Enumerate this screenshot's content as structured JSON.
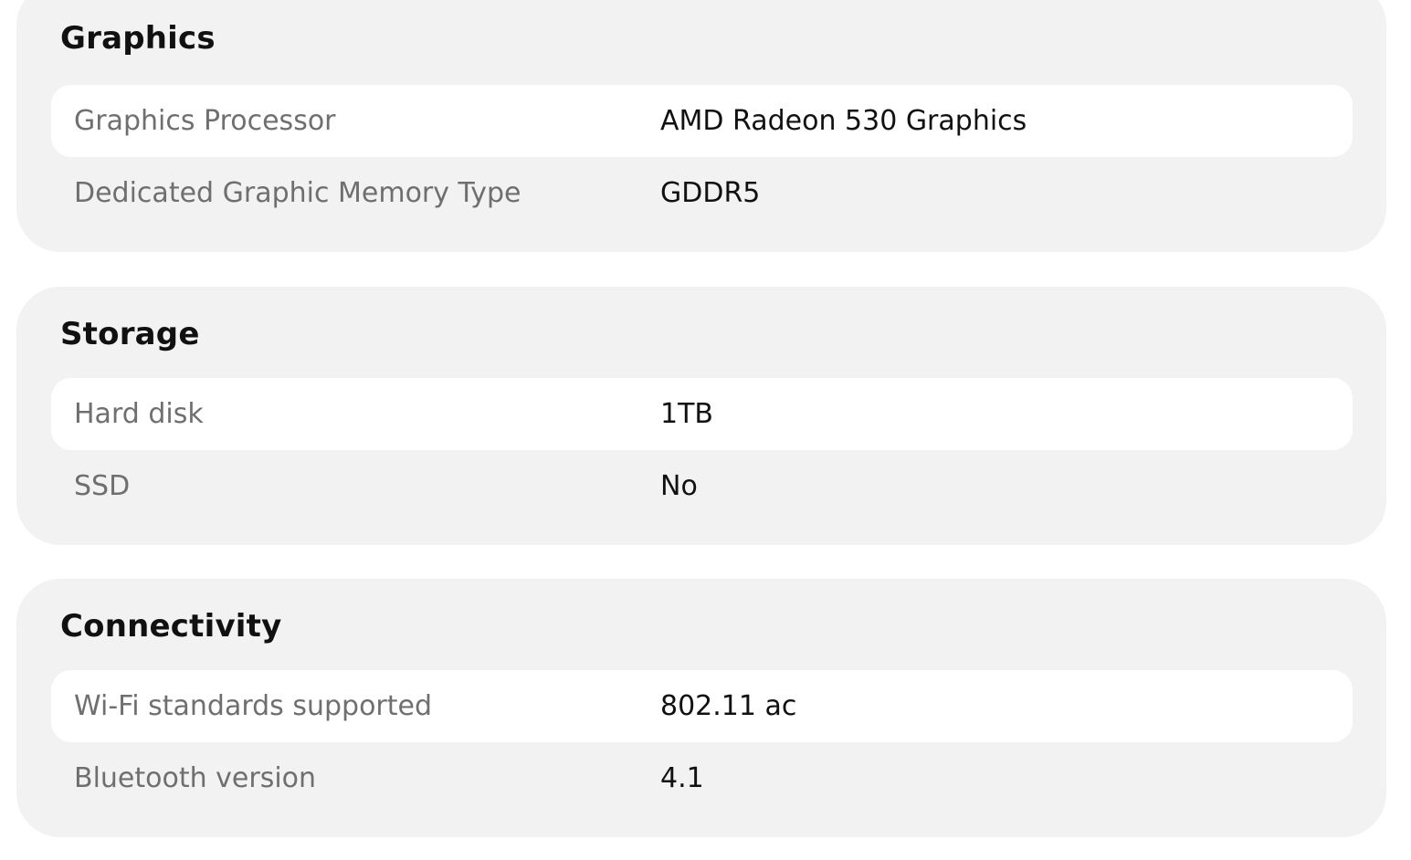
{
  "sections": [
    {
      "title": "Graphics",
      "rows": [
        {
          "label": "Graphics Processor",
          "value": "AMD Radeon 530 Graphics"
        },
        {
          "label": "Dedicated Graphic Memory Type",
          "value": "GDDR5"
        }
      ]
    },
    {
      "title": "Storage",
      "rows": [
        {
          "label": "Hard disk",
          "value": "1TB"
        },
        {
          "label": "SSD",
          "value": "No"
        }
      ]
    },
    {
      "title": "Connectivity",
      "rows": [
        {
          "label": "Wi-Fi standards supported",
          "value": "802.11 ac"
        },
        {
          "label": "Bluetooth version",
          "value": "4.1"
        }
      ]
    }
  ],
  "colors": {
    "card_background": "#f2f2f2",
    "row_highlight": "#ffffff",
    "label_text": "#6f6f6f",
    "value_text": "#111111"
  }
}
